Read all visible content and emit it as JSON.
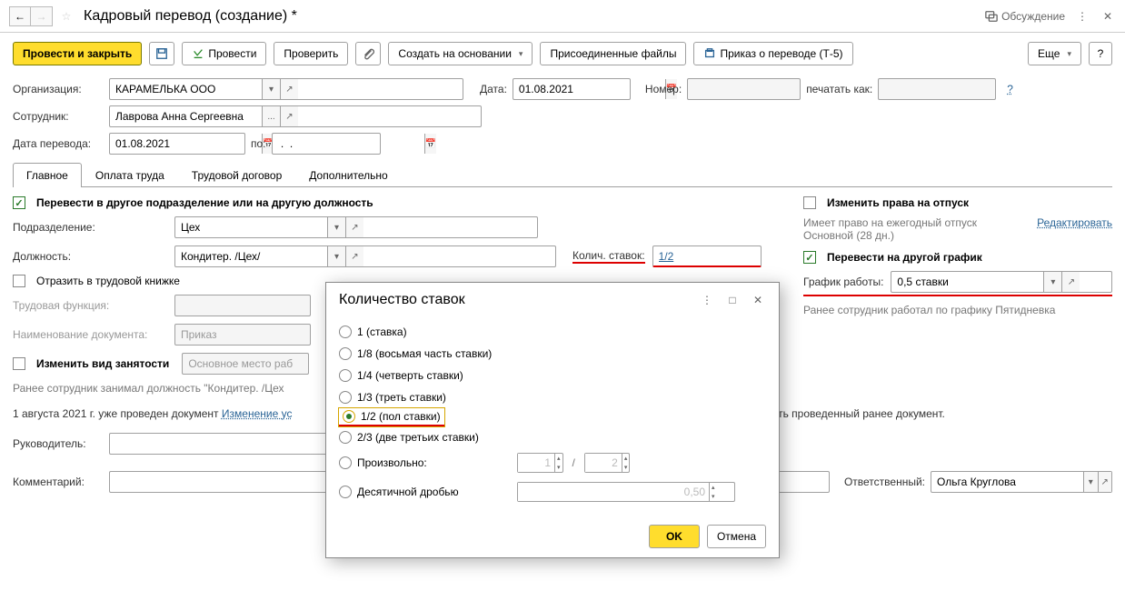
{
  "header": {
    "title": "Кадровый перевод (создание) *",
    "discuss": "Обсуждение"
  },
  "toolbar": {
    "post_close": "Провести и закрыть",
    "post": "Провести",
    "check": "Проверить",
    "create_based": "Создать на основании",
    "attached": "Присоединенные файлы",
    "order": "Приказ о переводе (Т-5)",
    "more": "Еще",
    "help": "?"
  },
  "fields": {
    "org_label": "Организация:",
    "org_value": "КАРАМЕЛЬКА ООО",
    "date_label": "Дата:",
    "date_value": "01.08.2021",
    "number_label": "Номер:",
    "number_value": "",
    "print_as_label": "печатать как:",
    "print_as_value": "",
    "employee_label": "Сотрудник:",
    "employee_value": "Лаврова Анна Сергеевна",
    "transfer_date_label": "Дата перевода:",
    "transfer_date_value": "01.08.2021",
    "to_label": "по:",
    "to_value": " .  .    "
  },
  "tabs": [
    "Главное",
    "Оплата труда",
    "Трудовой договор",
    "Дополнительно"
  ],
  "main": {
    "transfer_chk": "Перевести в другое подразделение или на другую должность",
    "dept_label": "Подразделение:",
    "dept_value": "Цех",
    "pos_label": "Должность:",
    "pos_value": "Кондитер. /Цех/",
    "rate_label": "Колич. ставок:",
    "rate_value": "1/2",
    "workbook_chk": "Отразить в трудовой книжке",
    "func_label": "Трудовая функция:",
    "func_value": "",
    "docname_label": "Наименование документа:",
    "docname_value": "Приказ",
    "emptype_chk": "Изменить вид занятости",
    "emptype_value": "Основное место раб",
    "prev_pos": "Ранее сотрудник занимал должность \"Кондитер. /Цех"
  },
  "right": {
    "vacation_chk": "Изменить права на отпуск",
    "vacation_info": "Имеет право на ежегодный отпуск Основной (28 дн.)",
    "edit_link": "Редактировать",
    "schedule_chk": "Перевести на другой график",
    "schedule_label": "График работы:",
    "schedule_value": "0,5 ставки",
    "prev_schedule": "Ранее сотрудник работал по графику Пятидневка"
  },
  "footer": {
    "note_prefix": "1 августа 2021 г. уже проведен документ ",
    "note_link": "Изменение ус",
    "note_suffix": "ывать проведенный ранее документ.",
    "manager_label": "Руководитель:",
    "manager_value": "",
    "comment_label": "Комментарий:",
    "comment_value": "",
    "responsible_label": "Ответственный:",
    "responsible_value": "Ольга Круглова"
  },
  "modal": {
    "title": "Количество ставок",
    "options": {
      "o1": "1 (ставка)",
      "o18": "1/8 (восьмая часть ставки)",
      "o14": "1/4 (четверть ставки)",
      "o13": "1/3 (треть ставки)",
      "o12": "1/2 (пол ставки)",
      "o23": "2/3 (две третьих ставки)",
      "custom": "Произвольно:",
      "decimal": "Десятичной дробью"
    },
    "custom_num": "1",
    "custom_sep": "/",
    "custom_den": "2",
    "decimal_val": "0,50",
    "ok": "OK",
    "cancel": "Отмена"
  }
}
